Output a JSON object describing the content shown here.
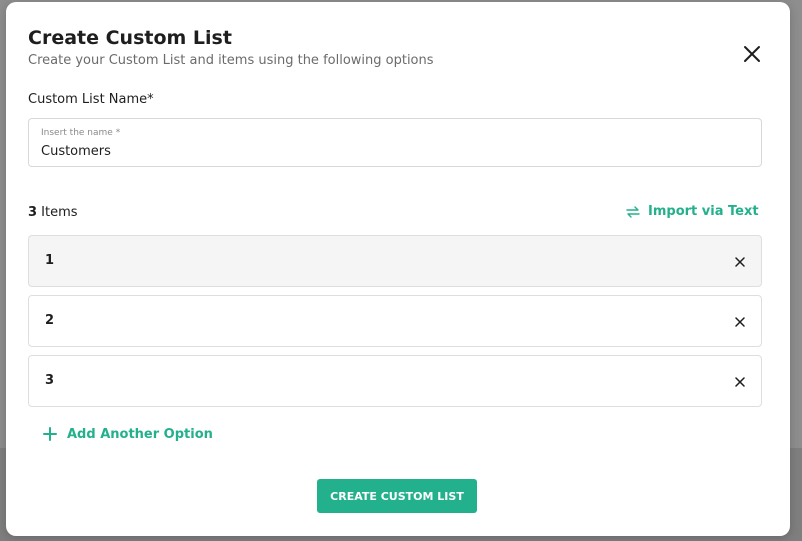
{
  "modal": {
    "title": "Create Custom List",
    "subtitle": "Create your Custom List and items using the following options",
    "close_icon": "close-icon"
  },
  "name_field": {
    "label": "Custom List Name*",
    "float_label": "Insert the name *",
    "value": "Customers"
  },
  "items_header": {
    "count": "3",
    "count_suffix": " Items",
    "import_label": "Import via Text",
    "import_icon": "swap-arrows-icon"
  },
  "items": [
    {
      "label": "1"
    },
    {
      "label": "2"
    },
    {
      "label": "3"
    }
  ],
  "add_option": {
    "label": "Add Another Option",
    "icon": "plus-icon"
  },
  "submit": {
    "label": "CREATE CUSTOM LIST"
  },
  "colors": {
    "accent": "#23b08c",
    "overlay": "#8e8e8e"
  }
}
